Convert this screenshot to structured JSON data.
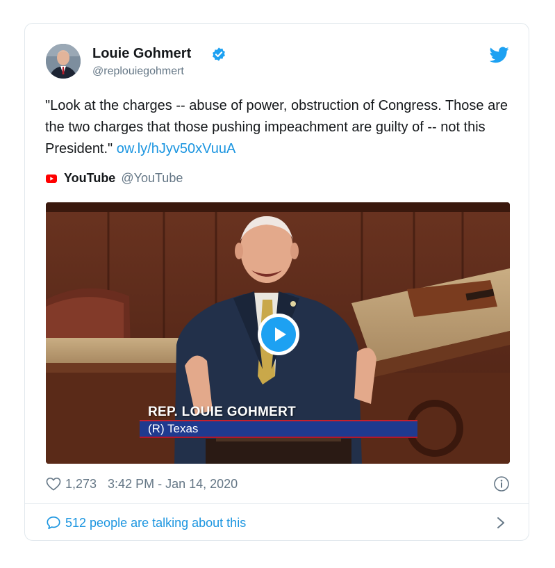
{
  "author": {
    "display_name": "Louie Gohmert",
    "handle": "@replouiegohmert"
  },
  "tweet": {
    "text": "\"Look at the charges -- abuse of power, obstruction of Congress. Those are the two charges that those pushing impeachment are guilty of -- not this President.\" ",
    "link": "ow.ly/hJyv50xVuuA"
  },
  "source": {
    "name": "YouTube",
    "handle": "@YouTube"
  },
  "video": {
    "chyron_name": "REP. LOUIE GOHMERT",
    "chyron_sub": "(R) Texas"
  },
  "meta": {
    "likes": "1,273",
    "timestamp": "3:42 PM - Jan 14, 2020"
  },
  "footer": {
    "talking": "512 people are talking about this"
  },
  "icons": {
    "verified": "verified-badge-icon",
    "bird": "twitter-bird-icon",
    "youtube": "youtube-icon",
    "play": "play-icon",
    "heart": "heart-icon",
    "info": "info-icon",
    "comment": "comment-icon",
    "chevron": "chevron-right-icon"
  },
  "colors": {
    "accent": "#1da1f2",
    "link": "#1b95e0",
    "muted": "#657786",
    "text": "#14171a",
    "youtube_red": "#ff0000"
  }
}
